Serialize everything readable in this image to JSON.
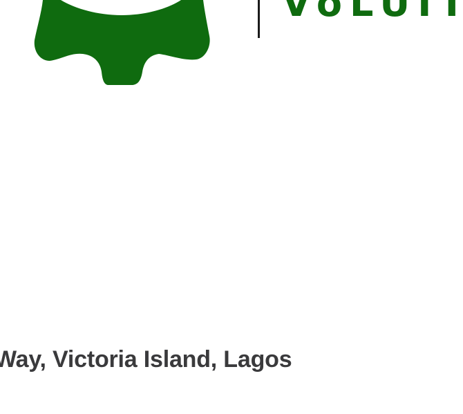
{
  "brand": {
    "wordmark": "VoLUIT",
    "color": "#0f6b0f"
  },
  "footer": {
    "address": "Way, Victoria Island, Lagos",
    "text_color": "#3a3a3c"
  }
}
